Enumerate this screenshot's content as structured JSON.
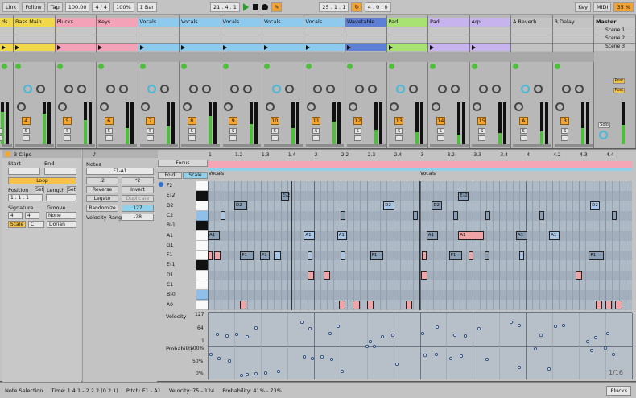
{
  "topbar": {
    "link": "Link",
    "follow": "Follow",
    "tap": "Tap",
    "tempo": "100.00",
    "timesig": "4 / 4",
    "zoom_pct": "100%",
    "quant": "1 Bar",
    "position": "21 . 4 . 1",
    "loop_start": "25 . 1 . 1",
    "loop_len": "4 . 0 . 0",
    "key_label": "Key",
    "midi_label": "MIDI",
    "cpu": "35 %"
  },
  "tracks": [
    {
      "name": "ds",
      "color": "#f1d84a",
      "num": ""
    },
    {
      "name": "Bass Main",
      "color": "#f1d84a",
      "num": "4"
    },
    {
      "name": "Plucks",
      "color": "#f4a2b8",
      "num": "5"
    },
    {
      "name": "Keys",
      "color": "#f4a2b8",
      "num": "6"
    },
    {
      "name": "Vocals",
      "color": "#8ec9ee",
      "num": "7"
    },
    {
      "name": "Vocals",
      "color": "#8ec9ee",
      "num": "8"
    },
    {
      "name": "Vocals",
      "color": "#8ec9ee",
      "num": "9"
    },
    {
      "name": "Vocals",
      "color": "#8ec9ee",
      "num": "10"
    },
    {
      "name": "Vocals",
      "color": "#8ec9ee",
      "num": "11"
    },
    {
      "name": "Wavetable",
      "color": "#5d7fd6",
      "num": "12"
    },
    {
      "name": "Pad",
      "color": "#a8e272",
      "num": "13"
    },
    {
      "name": "Pad",
      "color": "#c7b3ee",
      "num": "14"
    },
    {
      "name": "Arp",
      "color": "#c7b3ee",
      "num": "15"
    },
    {
      "name": "A Reverb",
      "color": "#c3c3c3",
      "num": "A"
    },
    {
      "name": "B Delay",
      "color": "#c3c3c3",
      "num": "B"
    }
  ],
  "master": {
    "name": "Master",
    "scenes": [
      "Scene 1",
      "Scene 2",
      "Scene 3"
    ],
    "post": "Post",
    "solo": "Solo"
  },
  "clip": {
    "title": "3 Clips",
    "start": "Start",
    "end": "End",
    "loop": "Loop",
    "position": "Position",
    "length": "Length",
    "set": "Set",
    "pos_val": "1  .  1  .  1",
    "signature": "Signature",
    "groove": "Groove",
    "sig_num": "4",
    "sig_den": "4",
    "groove_val": "None",
    "scale_btn": "Scale",
    "scale_root": "C",
    "scale_name": "Dorian"
  },
  "notes_panel": {
    "title": "Notes",
    "range": "F1-A1",
    "half": ":2",
    "double": "*2",
    "reverse": "Reverse",
    "invert": "Invert",
    "legato": "Legato",
    "duplicate": "Duplicate",
    "randomize": "Randomize",
    "rand_val": "127",
    "velocity_range": "Velocity Range",
    "vr_val": "-28"
  },
  "roll": {
    "focus": "Focus",
    "fold": "Fold",
    "scale": "Scale",
    "clip_label_a": "Vocals",
    "clip_label_b": "Vocals",
    "timeline": [
      "1",
      "1.2",
      "1.3",
      "1.4",
      "2",
      "2.2",
      "2.3",
      "2.4",
      "3",
      "3.2",
      "3.3",
      "3.4",
      "4",
      "4.2",
      "4.3",
      "4.4"
    ],
    "key_labels": [
      "F2",
      "E♭2",
      "D2",
      "C2",
      "B♭1",
      "A1",
      "G1",
      "F1",
      "E♭1",
      "D1",
      "C1",
      "B♭0",
      "A0"
    ],
    "velocity": "Velocity",
    "vel_max": "127",
    "vel_mid": "64",
    "vel_min": "1",
    "probability": "Probability",
    "prob_max": "100%",
    "prob_mid": "50%",
    "prob_min": "0%",
    "grid": "1/16"
  },
  "statusbar": {
    "sel": "Note Selection",
    "time": "Time: 1.4.1 - 2.2.2 (0.2.1)",
    "pitch": "Pitch: F1 - A1",
    "velocity": "Velocity: 75 - 124",
    "probability": "Probability: 41% - 73%",
    "track": "Plucks"
  }
}
